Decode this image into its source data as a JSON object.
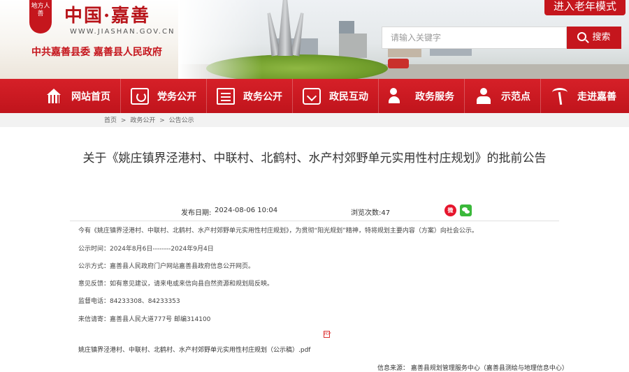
{
  "header": {
    "logo_text": "地方人善",
    "site_name": "中国·嘉善",
    "domain": "WWW.JIASHAN.GOV.CN",
    "subtitle": "中共嘉善县委  嘉善县人民政府",
    "elder_mode": "进入老年模式",
    "search_placeholder": "请输入关键字",
    "search_button": "搜索"
  },
  "nav": {
    "items": [
      {
        "label": "网站首页",
        "icon": "home-icon"
      },
      {
        "label": "党务公开",
        "icon": "party-icon"
      },
      {
        "label": "政务公开",
        "icon": "document-icon"
      },
      {
        "label": "政民互动",
        "icon": "chat-icon"
      },
      {
        "label": "政务服务",
        "icon": "service-icon"
      },
      {
        "label": "示范点",
        "icon": "people-icon"
      },
      {
        "label": "走进嘉善",
        "icon": "palm-icon"
      }
    ]
  },
  "breadcrumb": [
    "首页",
    ">",
    "政务公开",
    ">",
    "公告公示"
  ],
  "article": {
    "title": "关于《姚庄镇界泾港村、中联村、北鹤村、水产村郊野单元实用性村庄规划》的批前公告",
    "date_label": "发布日期:",
    "date": "2024-08-06 10:04",
    "views": "浏览次数:47",
    "paragraphs": [
      "今有《姚庄镇界泾港村、中联村、北鹤村、水产村郊野单元实用性村庄规划》，为贯彻“阳光规划”精神，特将规划主要内容（方案）向社会公示。",
      "公示时间：2024年8月6日--------2024年9月4日",
      "公示方式：嘉善县人民政府门户网站嘉善县政府信息公开网页。",
      "意见反馈：如有意见建议，请来电或来信向县自然资源和规划局反映。",
      "监督电话：84233308、84233353",
      "来信请寄：嘉善县人民大道777号 邮编314100"
    ],
    "pdf_icon_label": "PDF",
    "attachment": "姚庄镇界泾港村、中联村、北鹤村、水产村郊野单元实用性村庄规划（公示稿）.pdf",
    "source": "信息来源：  嘉善县规划管理服务中心（嘉善县测绘与地理信息中心）"
  },
  "share": {
    "weibo": "微",
    "weixin": ""
  },
  "colors": {
    "brand_red": "#c5161d",
    "nav_red": "#d62028"
  }
}
